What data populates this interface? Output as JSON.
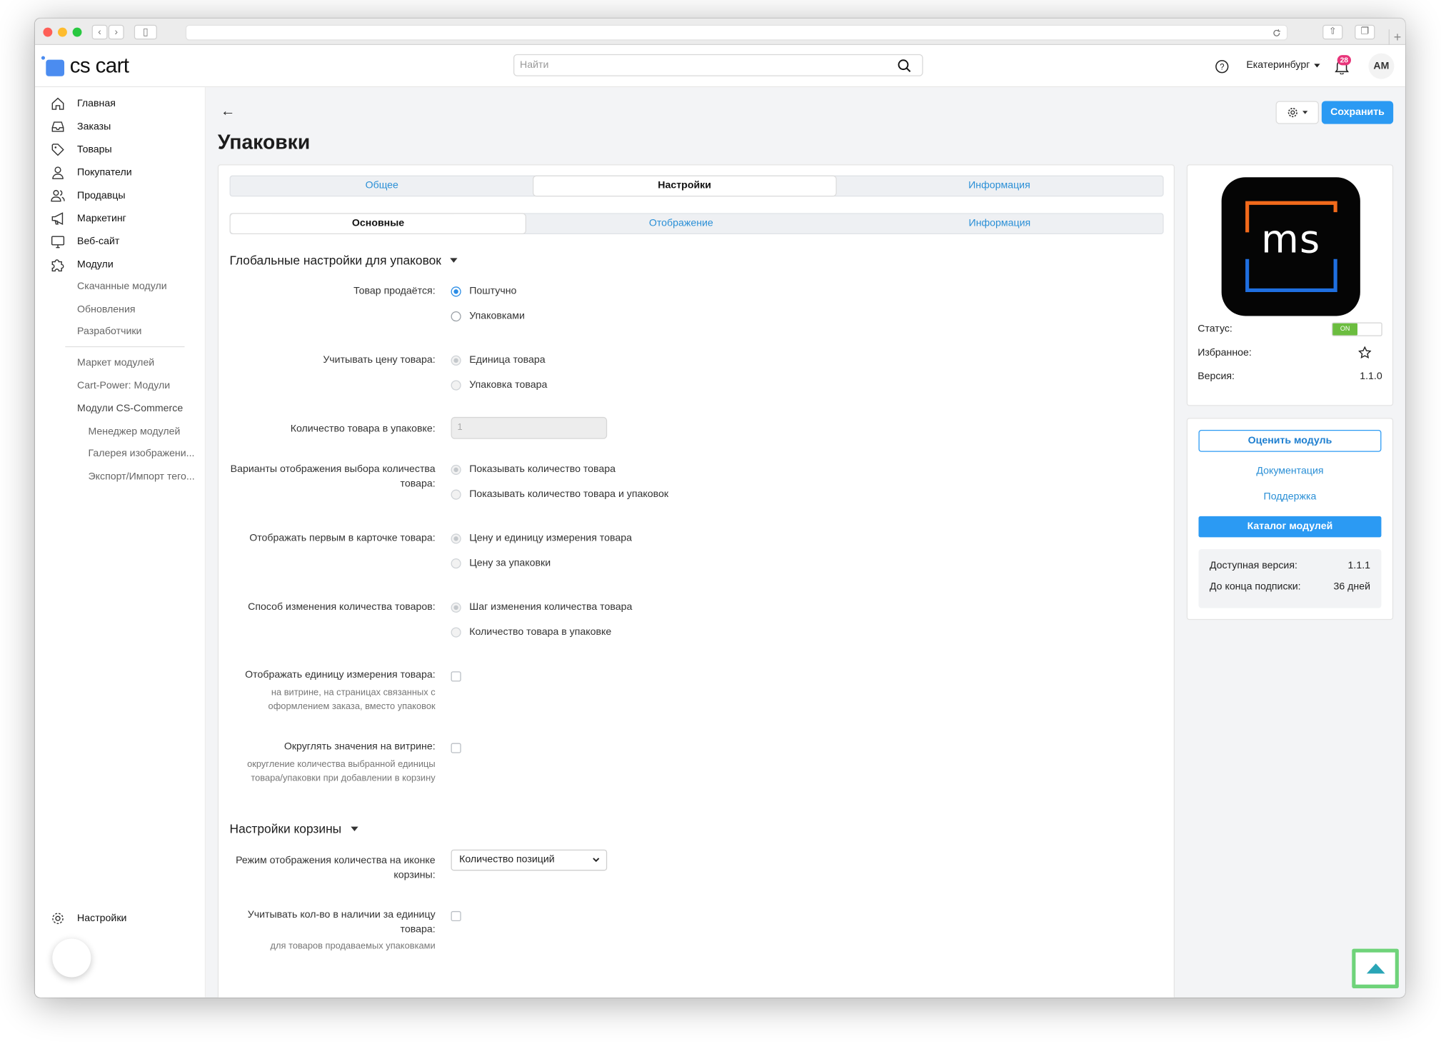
{
  "app": {
    "logo_text": "cs cart"
  },
  "header": {
    "search_placeholder": "Найти",
    "city": "Екатеринбург",
    "notifications_count": "28",
    "avatar_initials": "AM"
  },
  "sidebar": {
    "items": [
      {
        "label": "Главная",
        "icon": "home-icon"
      },
      {
        "label": "Заказы",
        "icon": "inbox-icon"
      },
      {
        "label": "Товары",
        "icon": "tag-icon"
      },
      {
        "label": "Покупатели",
        "icon": "user-icon"
      },
      {
        "label": "Продавцы",
        "icon": "users-icon"
      },
      {
        "label": "Маркетинг",
        "icon": "megaphone-icon"
      },
      {
        "label": "Веб-сайт",
        "icon": "monitor-icon"
      },
      {
        "label": "Модули",
        "icon": "puzzle-icon"
      }
    ],
    "sub_items": [
      "Скачанные модули",
      "Обновления",
      "Разработчики"
    ],
    "sub_items2": [
      "Маркет модулей",
      "Cart-Power: Модули",
      "Модули CS-Commerce"
    ],
    "sub_items3": [
      "Менеджер модулей",
      "Галерея изображени...",
      "Экспорт/Импорт тего..."
    ],
    "settings_label": "Настройки"
  },
  "page": {
    "title": "Упаковки",
    "save_label": "Сохранить"
  },
  "tabs_top": {
    "items": [
      "Общее",
      "Настройки",
      "Информация"
    ],
    "active_index": 1
  },
  "tabs_sub": {
    "items": [
      "Основные",
      "Отображение",
      "Информация"
    ],
    "active_index": 0
  },
  "sections": {
    "global_title": "Глобальные настройки для упаковок",
    "cart_title": "Настройки корзины"
  },
  "fields": {
    "sold_label": "Товар продаётся:",
    "sold_options": [
      "Поштучно",
      "Упаковками"
    ],
    "price_label": "Учитывать цену товара:",
    "price_options": [
      "Единица товара",
      "Упаковка товара"
    ],
    "qty_label": "Количество товара в упаковке:",
    "qty_value": "1",
    "display_variants_label": "Варианты отображения выбора количества товара:",
    "display_variants_options": [
      "Показывать количество товара",
      "Показывать количество товара и упаковок"
    ],
    "show_first_label": "Отображать первым в карточке товара:",
    "show_first_options": [
      "Цену и единицу измерения товара",
      "Цену за упаковки"
    ],
    "change_method_label": "Способ изменения количества товаров:",
    "change_method_options": [
      "Шаг изменения количества товара",
      "Количество товара в упаковке"
    ],
    "show_unit_label": "Отображать единицу измерения товара:",
    "show_unit_hint1": "на витрине, на страницах связанных с",
    "show_unit_hint2": "оформлением заказа, вместо упаковок",
    "round_label": "Округлять значения на витрине:",
    "round_hint1": "округление количества выбранной единицы",
    "round_hint2": "товара/упаковки при добавлении в корзину",
    "cart_icon_label": "Режим отображения количества на иконке корзины:",
    "cart_icon_value": "Количество позиций",
    "stock_label": "Учитывать кол-во в наличии за единицу товара:",
    "stock_hint": "для товаров продаваемых упаковками"
  },
  "module_card": {
    "logo_text": "ms",
    "status_label": "Статус:",
    "status_value": "ON",
    "favorite_label": "Избранное:",
    "version_label": "Версия:",
    "version_value": "1.1.0"
  },
  "actions_card": {
    "rate_label": "Оценить модуль",
    "docs_label": "Документация",
    "support_label": "Поддержка",
    "catalog_label": "Каталог модулей",
    "available_label": "Доступная версия:",
    "available_value": "1.1.1",
    "subscription_label": "До конца подписки:",
    "subscription_value": "36 дней"
  },
  "colors": {
    "accent": "#2b9af3",
    "link": "#2a8fd6",
    "toggle_on": "#6bbd3f",
    "badge": "#e8357a",
    "scrolltop_border": "#6fd37a"
  }
}
